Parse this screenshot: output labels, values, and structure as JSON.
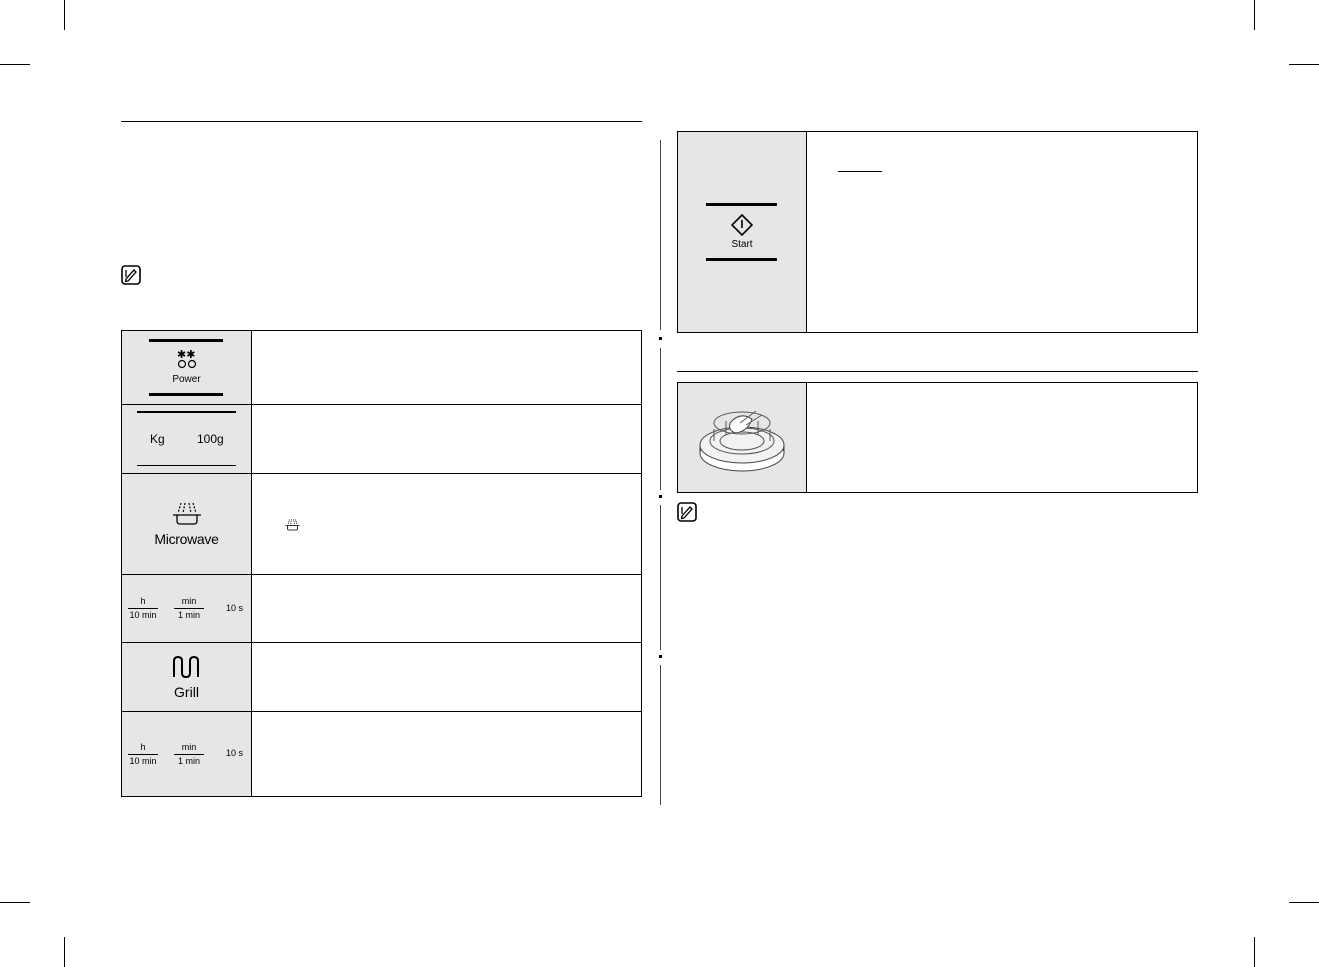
{
  "panel": {
    "power_label": "Power",
    "weight_kg": "Kg",
    "weight_100g": "100g",
    "microwave_label": "Microwave",
    "grill_label": "Grill",
    "start_label": "Start",
    "time_buttons": {
      "hour": "h",
      "hour_step": "10 min",
      "minute": "min",
      "minute_step": "1 min",
      "seconds_step": "10 s"
    }
  },
  "icons": {
    "note": "note-icon",
    "power": "power-icon",
    "microwave": "microwave-icon",
    "grill": "grill-icon",
    "start": "start-diamond-icon",
    "turntable": "turntable-image"
  },
  "colors": {
    "icon_cell_bg": "#e6e6e6",
    "rule": "#000000"
  }
}
